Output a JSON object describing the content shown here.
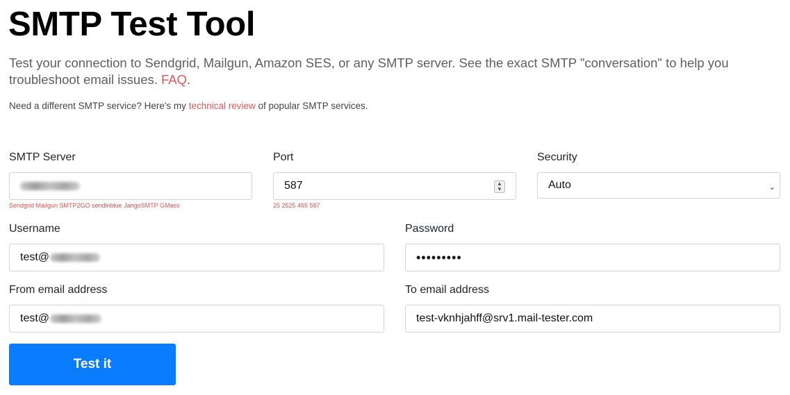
{
  "title": "SMTP Test Tool",
  "lead": {
    "text": "Test your connection to Sendgrid, Mailgun, Amazon SES, or any SMTP server. See the exact SMTP \"conversation\" to help you troubleshoot email issues. ",
    "faq_link": "FAQ",
    "end": "."
  },
  "note": {
    "before": "Need a different SMTP service? Here's my ",
    "link": "technical review",
    "after": " of popular SMTP services."
  },
  "form": {
    "smtp_server": {
      "label": "SMTP Server",
      "hint": "Sendgrid Mailgun SMTP2GO sendinblue JangoSMTP GMass"
    },
    "port": {
      "label": "Port",
      "value": "587",
      "hint": "25 2525 465 587"
    },
    "security": {
      "label": "Security",
      "value": "Auto"
    },
    "username": {
      "label": "Username",
      "value_prefix": "test@"
    },
    "password": {
      "label": "Password",
      "value": "•••••••••"
    },
    "from": {
      "label": "From email address",
      "value_prefix": "test@"
    },
    "to": {
      "label": "To email address",
      "value": "test-vknhjahff@srv1.mail-tester.com"
    },
    "submit_label": "Test it"
  }
}
